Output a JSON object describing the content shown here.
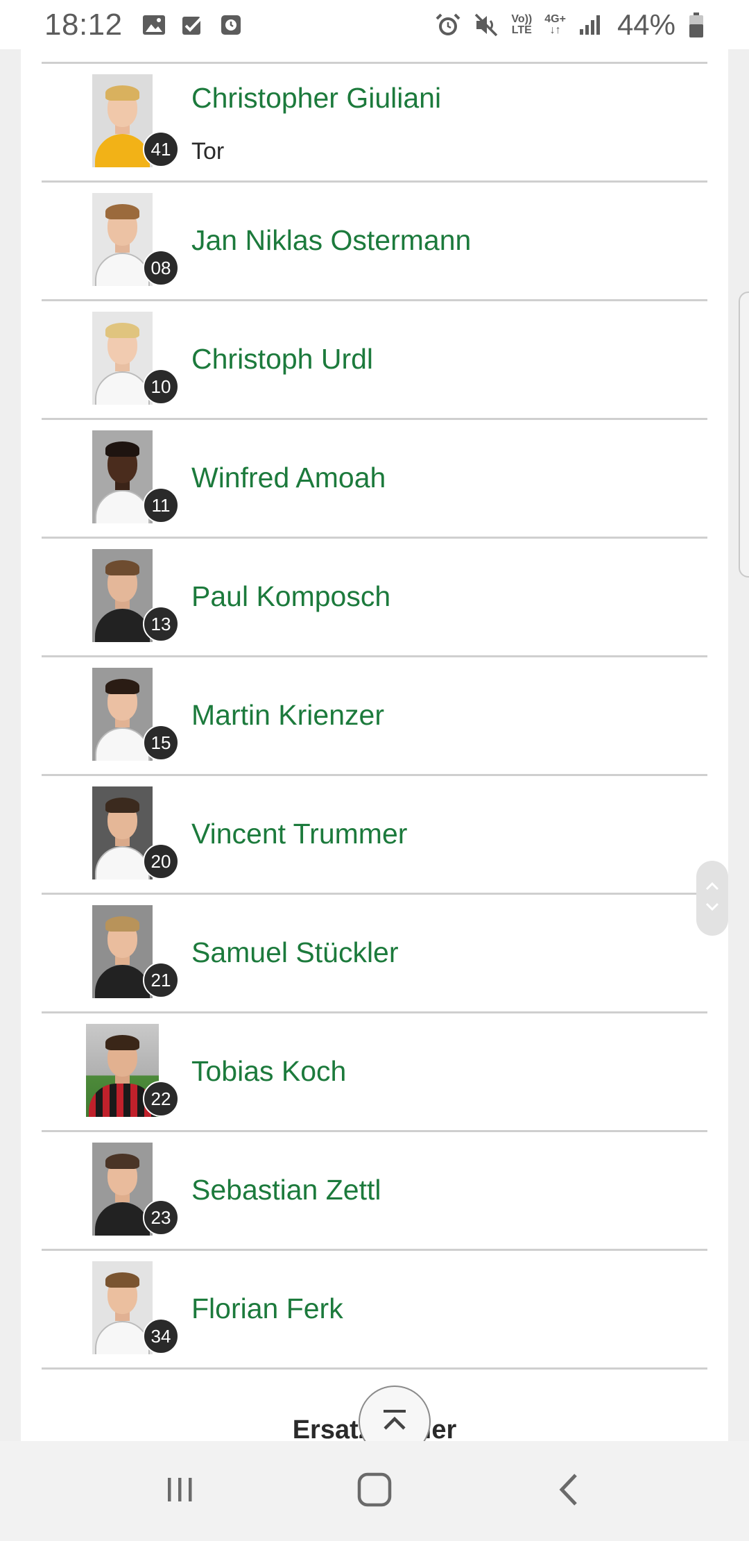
{
  "status_bar": {
    "time": "18:12",
    "left_icons": [
      "image-icon",
      "task-check-icon",
      "clock-app-icon"
    ],
    "right_icons": [
      "alarm-icon",
      "mute-icon",
      "volte-icon",
      "4g-data-icon",
      "signal-icon"
    ],
    "volte_label_top": "Vo))",
    "volte_label_bottom": "LTE",
    "network_label": "4G+",
    "battery_percent": "44%"
  },
  "players": [
    {
      "name": "Christopher Giuliani",
      "number": "41",
      "position": "Tor"
    },
    {
      "name": "Jan Niklas Ostermann",
      "number": "08"
    },
    {
      "name": "Christoph Urdl",
      "number": "10"
    },
    {
      "name": "Winfred Amoah",
      "number": "11"
    },
    {
      "name": "Paul Komposch",
      "number": "13"
    },
    {
      "name": "Martin Krienzer",
      "number": "15"
    },
    {
      "name": "Vincent Trummer",
      "number": "20"
    },
    {
      "name": "Samuel Stückler",
      "number": "21"
    },
    {
      "name": "Tobias Koch",
      "number": "22"
    },
    {
      "name": "Sebastian Zettl",
      "number": "23"
    },
    {
      "name": "Florian Ferk",
      "number": "34"
    }
  ],
  "section_heading": "Ersatzspieler",
  "nav_bar": {
    "buttons": [
      "recent-apps",
      "home",
      "back"
    ]
  },
  "colors": {
    "name_green": "#1c7a3c",
    "badge_dark": "#2a2a2a",
    "divider": "#cfcfcf"
  }
}
